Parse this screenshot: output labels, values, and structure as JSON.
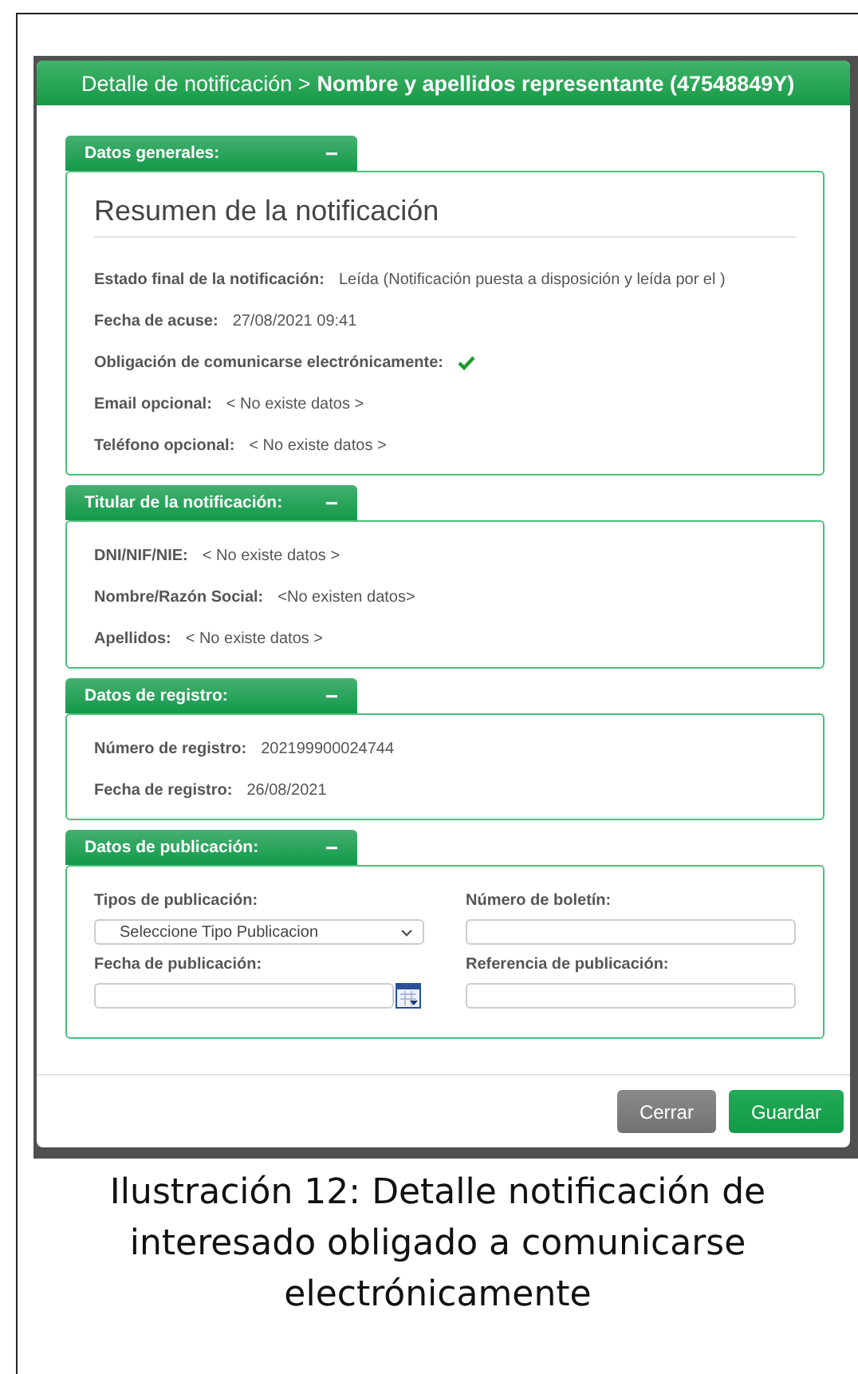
{
  "dialog": {
    "title_prefix": "Detalle de notificación >",
    "title_subject": "Nombre y apellidos representante (47548849Y)",
    "sections": [
      {
        "kind": "fields",
        "title": "Datos generales:",
        "toggle": "−",
        "expanded": true,
        "heading": "Resumen de la notificación",
        "fields": [
          {
            "kind": "text",
            "label": "Estado final de la notificación:",
            "value": "Leída (Notificación puesta a disposición y leída por el )"
          },
          {
            "kind": "text",
            "label": "Fecha de acuse:",
            "value": "27/08/2021 09:41"
          },
          {
            "kind": "check",
            "label": "Obligación de comunicarse electrónicamente:",
            "checked": true
          },
          {
            "kind": "text",
            "label": "Email opcional:",
            "value": "< No existe datos >"
          },
          {
            "kind": "text",
            "label": "Teléfono opcional:",
            "value": "< No existe datos >"
          }
        ]
      },
      {
        "kind": "fields",
        "title": "Titular de la notificación:",
        "toggle": "−",
        "expanded": true,
        "fields": [
          {
            "kind": "text",
            "label": "DNI/NIF/NIE:",
            "value": "< No existe datos >"
          },
          {
            "kind": "text",
            "label": "Nombre/Razón Social:",
            "value": "<No existen datos>"
          },
          {
            "kind": "text",
            "label": "Apellidos:",
            "value": "< No existe datos >"
          }
        ]
      },
      {
        "kind": "fields",
        "title": "Datos de registro:",
        "toggle": "−",
        "expanded": true,
        "fields": [
          {
            "kind": "text",
            "label": "Número de registro:",
            "value": "202199900024744"
          },
          {
            "kind": "text",
            "label": "Fecha de registro:",
            "value": "26/08/2021"
          }
        ]
      },
      {
        "kind": "form",
        "title": "Datos de publicación:",
        "toggle": "−",
        "expanded": true,
        "inputs": [
          {
            "kind": "select",
            "label": "Tipos de publicación:",
            "value": "Seleccione Tipo Publicacion"
          },
          {
            "kind": "text",
            "label": "Número de boletín:"
          },
          {
            "kind": "date",
            "label": "Fecha de publicación:"
          },
          {
            "kind": "text",
            "label": "Referencia de publicación:"
          }
        ]
      }
    ],
    "buttons": [
      {
        "label": "Cerrar",
        "kind": "secondary"
      },
      {
        "label": "Guardar",
        "kind": "primary"
      }
    ]
  },
  "caption": "Ilustración 12: Detalle notificación de interesado obligado a comunicarse electrónicamente"
}
